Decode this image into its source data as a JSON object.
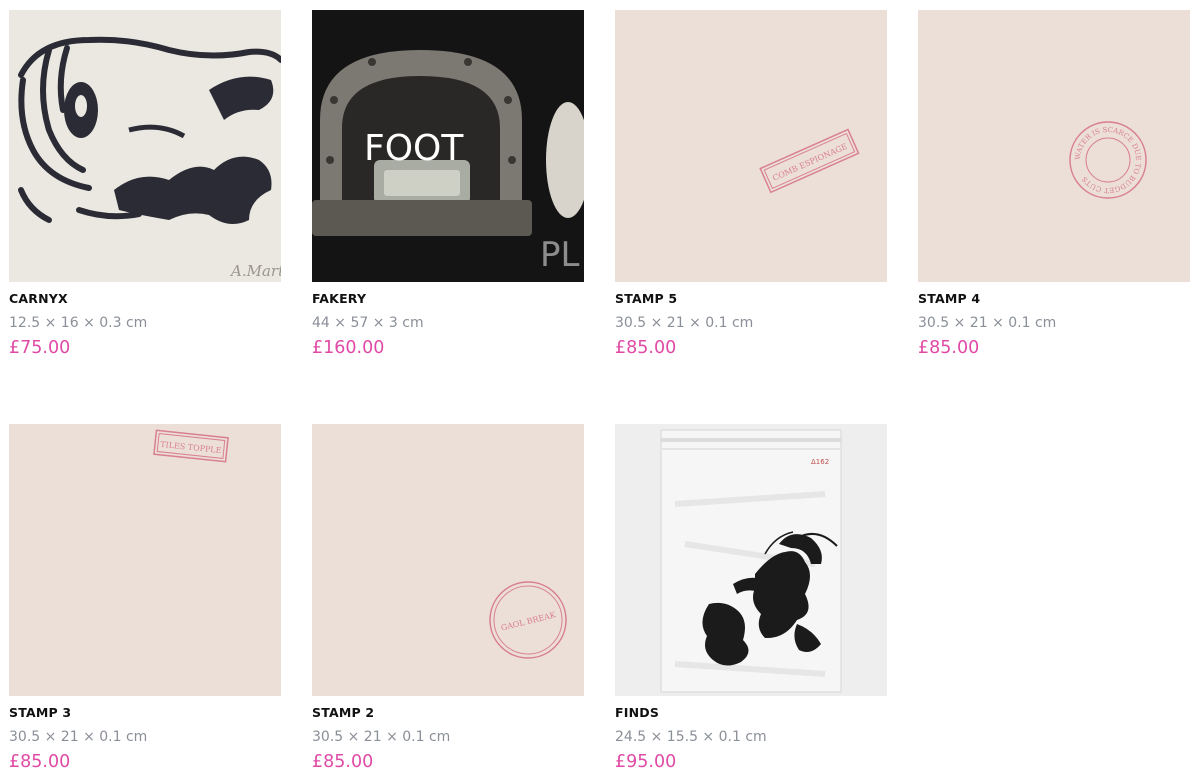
{
  "products": [
    {
      "title": "CARNYX",
      "dims": "12.5 × 16 × 0.3 cm",
      "price": "£75.00",
      "art_signature": "A.Marti"
    },
    {
      "title": "FAKERY",
      "dims": "44 × 57 × 3 cm",
      "price": "£160.00",
      "art_text": "FOOT",
      "art_text_2": "PL"
    },
    {
      "title": "STAMP 5",
      "dims": "30.5 × 21 × 0.1 cm",
      "price": "£85.00",
      "stamp_text": "COMB ESPIONAGE"
    },
    {
      "title": "STAMP 4",
      "dims": "30.5 × 21 × 0.1 cm",
      "price": "£85.00",
      "stamp_text": "WATER IS SCARCE DUE TO BUDGET CUTS"
    },
    {
      "title": "STAMP 3",
      "dims": "30.5 × 21 × 0.1 cm",
      "price": "£85.00",
      "stamp_text": "TILES TOPPLE"
    },
    {
      "title": "STAMP 2",
      "dims": "30.5 × 21 × 0.1 cm",
      "price": "£85.00",
      "stamp_text": "GAOL BREAK"
    },
    {
      "title": "FINDS",
      "dims": "24.5 × 15.5 × 0.1 cm",
      "price": "£95.00",
      "bag_label": "Δ162"
    }
  ],
  "colors": {
    "price": "#e04aa6",
    "title": "#111111",
    "dims": "#8a8f98",
    "stamp_ink": "#d9808f",
    "paper_pink": "#ecdfd8"
  }
}
